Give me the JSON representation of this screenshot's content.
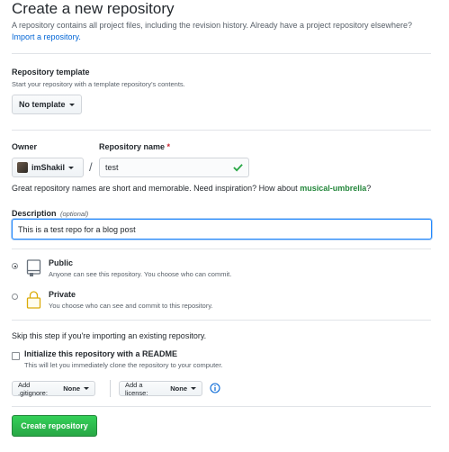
{
  "header": {
    "title": "Create a new repository",
    "intro_text": "A repository contains all project files, including the revision history. Already have a project repository elsewhere?",
    "import_link": "Import a repository."
  },
  "template": {
    "label": "Repository template",
    "description": "Start your repository with a template repository's contents.",
    "button_label": "No template"
  },
  "owner": {
    "label": "Owner",
    "value": "imShakil"
  },
  "separator": "/",
  "repo_name": {
    "label": "Repository name",
    "required_mark": "*",
    "value": "test"
  },
  "suggestion": {
    "text": "Great repository names are short and memorable. Need inspiration? How about",
    "name": "musical-umbrella",
    "end": "?"
  },
  "description_field": {
    "label": "Description",
    "optional": "(optional)",
    "value": "This is a test repo for a blog post"
  },
  "visibility": {
    "public": {
      "title": "Public",
      "description": "Anyone can see this repository. You choose who can commit.",
      "selected": true
    },
    "private": {
      "title": "Private",
      "description": "You choose who can see and commit to this repository.",
      "selected": false
    }
  },
  "init": {
    "skip_text": "Skip this step if you're importing an existing repository.",
    "readme_label": "Initialize this repository with a README",
    "readme_description": "This will let you immediately clone the repository to your computer.",
    "readme_checked": false
  },
  "gitignore": {
    "prefix": "Add .gitignore:",
    "value": "None"
  },
  "license": {
    "prefix": "Add a license:",
    "value": "None"
  },
  "submit_label": "Create repository",
  "colors": {
    "accent_green": "#28a745",
    "link_blue": "#0366d6",
    "focus_border": "#2188ff",
    "suggestion_green": "#22863a"
  }
}
